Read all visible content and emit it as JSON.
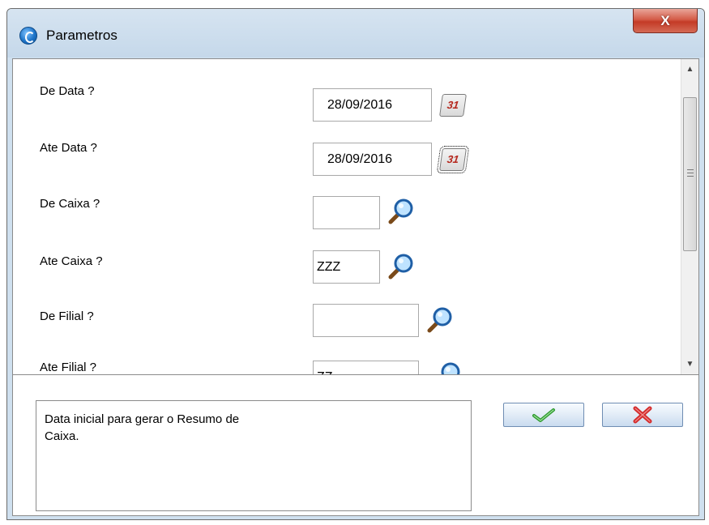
{
  "window": {
    "title": "Parametros",
    "close_label": "X"
  },
  "params": [
    {
      "label": "De Data ?",
      "value": "28/09/2016",
      "button": "calendar-icon"
    },
    {
      "label": "Ate Data ?",
      "value": "28/09/2016",
      "button": "calendar-icon"
    },
    {
      "label": "De Caixa ?",
      "value": "",
      "button": "search-icon"
    },
    {
      "label": "Ate Caixa ?",
      "value": "ZZZ",
      "button": "search-icon"
    },
    {
      "label": "De Filial ?",
      "value": "",
      "button": "search-icon"
    },
    {
      "label": "Ate Filial ?",
      "value": "ZZ",
      "button": "search-icon"
    }
  ],
  "calendar_icon_text": "31",
  "description": "Data inicial para gerar o Resumo de\nCaixa.",
  "buttons": {
    "ok_icon": "checkmark-icon",
    "cancel_icon": "x-icon"
  },
  "colors": {
    "ok": "#2f9a2f",
    "cancel": "#d42a2a",
    "titlebar": "#c5d8ea",
    "close": "#c43a26"
  }
}
